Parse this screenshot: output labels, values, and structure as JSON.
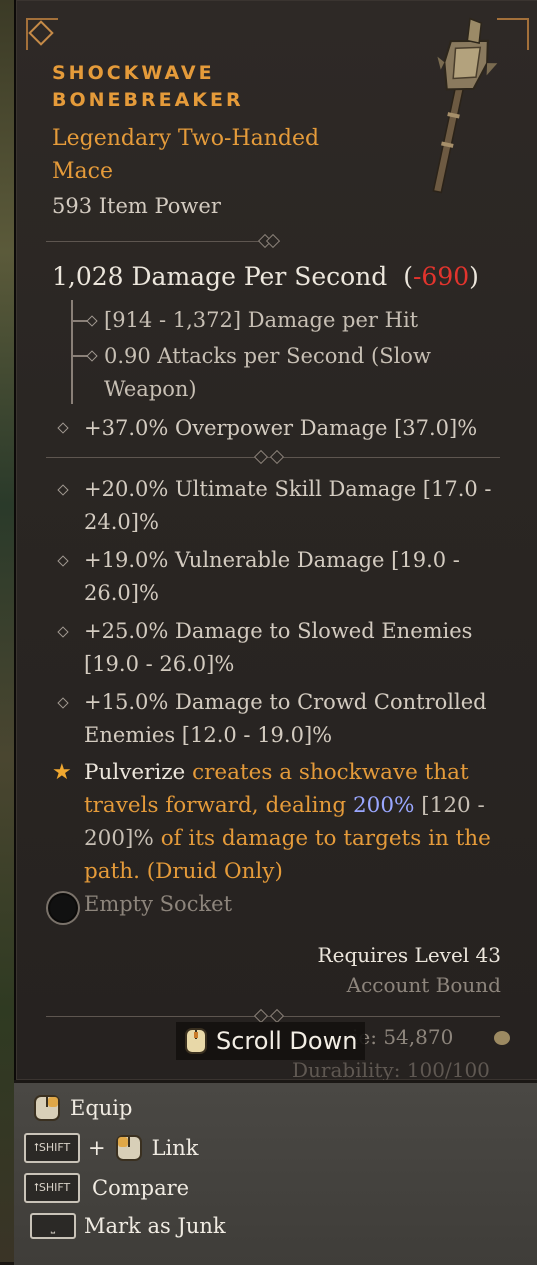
{
  "item": {
    "name_line1": "SHOCKWAVE",
    "name_line2": "BONEBREAKER",
    "type_line1": "Legendary Two-Handed",
    "type_line2": "Mace",
    "item_power": "593 Item Power"
  },
  "damage": {
    "dps_text": "1,028 Damage Per Second",
    "dps_open": "(",
    "dps_diff": "-690",
    "dps_close": ")",
    "per_hit": "[914 - 1,372] Damage per Hit",
    "attacks_line1": "0.90 Attacks per Second (Slow",
    "attacks_line2": "Weapon)",
    "implicit": "+37.0% Overpower Damage [37.0]%"
  },
  "affixes": [
    {
      "line1": "+20.0% Ultimate Skill Damage [17.0 -",
      "line2": "24.0]%"
    },
    {
      "line1": "+19.0% Vulnerable Damage [19.0 -",
      "line2": "26.0]%"
    },
    {
      "line1": "+25.0% Damage to Slowed Enemies",
      "line2": "[19.0 - 26.0]%"
    },
    {
      "line1": "+15.0% Damage to Crowd Controlled",
      "line2": "Enemies [12.0 - 19.0]%"
    }
  ],
  "legendary_aspect": {
    "skill": "Pulverize",
    "text1": " creates a shockwave that",
    "text2": "travels forward, dealing ",
    "value": "200%",
    "range1": " [120 -",
    "range2": "200]%",
    "text3": " of its damage to targets in the",
    "text4": "path. (Druid Only)"
  },
  "socket_label": "Empty Socket",
  "requirements": {
    "level": "Requires Level 43",
    "bound": "Account Bound"
  },
  "sell": {
    "price_partial": "ie: 54,870",
    "durability_partial": "Durability: 100/100"
  },
  "scroll_hint": "Scroll Down",
  "footer": {
    "equip": "Equip",
    "shift_key": "SHIFT",
    "plus": "+",
    "link": "Link",
    "compare": "Compare",
    "junk": "Mark as Junk"
  },
  "colors": {
    "legendary_orange": "#e59b3a",
    "negative_red": "#e2342d",
    "value_blue": "#9aa7ff"
  },
  "icons": [
    "mouse-left-icon",
    "mouse-right-icon",
    "shift-key-icon",
    "space-key-icon",
    "star-icon",
    "socket-icon",
    "gold-coin-icon",
    "mace-icon"
  ]
}
